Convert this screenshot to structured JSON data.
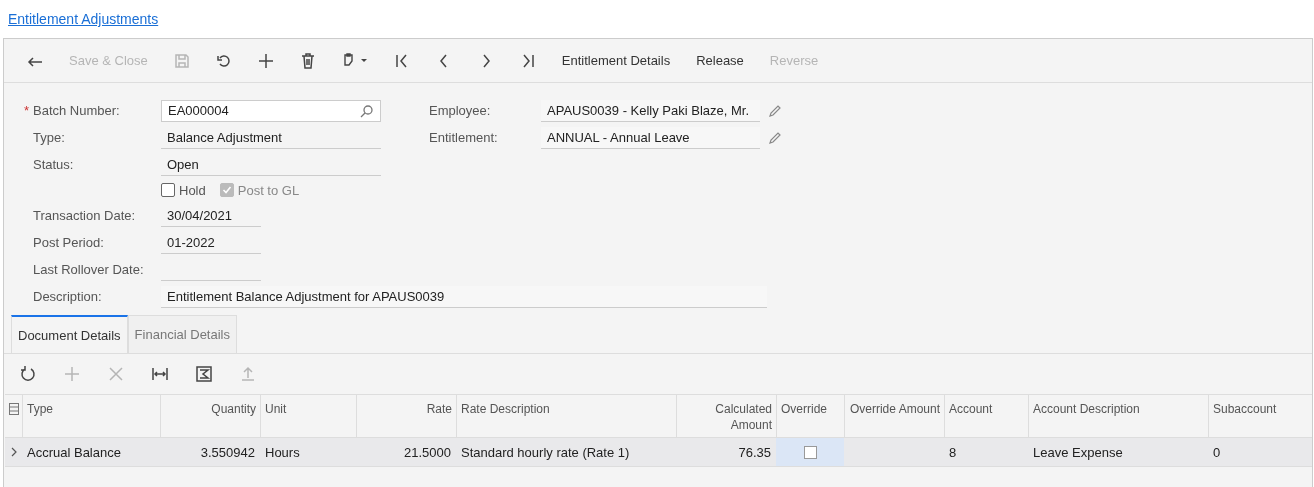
{
  "title": "Entitlement Adjustments",
  "toolbar": [
    {
      "kind": "back",
      "disabled": false
    },
    {
      "kind": "text",
      "label": "Save & Close",
      "disabled": true
    },
    {
      "kind": "save",
      "disabled": true
    },
    {
      "kind": "undo",
      "disabled": false
    },
    {
      "kind": "add",
      "disabled": false
    },
    {
      "kind": "delete",
      "disabled": false
    },
    {
      "kind": "clipboard",
      "disabled": false
    },
    {
      "kind": "first",
      "disabled": false
    },
    {
      "kind": "prev",
      "disabled": false
    },
    {
      "kind": "next",
      "disabled": false
    },
    {
      "kind": "last",
      "disabled": false
    },
    {
      "kind": "text",
      "label": "Entitlement Details",
      "disabled": false
    },
    {
      "kind": "text",
      "label": "Release",
      "disabled": false
    },
    {
      "kind": "text",
      "label": "Reverse",
      "disabled": true
    }
  ],
  "form": {
    "left": [
      {
        "label": "Batch Number:",
        "value": "EA000004",
        "marker": "*",
        "kind": "lookup"
      },
      {
        "label": "Type:",
        "value": "Balance Adjustment",
        "kind": "text"
      },
      {
        "label": "Status:",
        "value": "Open",
        "kind": "text"
      }
    ],
    "checkboxes": [
      {
        "label": "Hold",
        "checked": false,
        "disabled": false
      },
      {
        "label": "Post to GL",
        "checked": true,
        "disabled": true
      }
    ],
    "dates": [
      {
        "label": "Transaction Date:",
        "value": "30/04/2021"
      },
      {
        "label": "Post Period:",
        "value": "01-2022"
      },
      {
        "label": "Last Rollover Date:"
      }
    ],
    "description": {
      "label": "Description:",
      "value": "Entitlement  Balance Adjustment for APAUS0039"
    },
    "right": [
      {
        "label": "Employee:",
        "value": "APAUS0039 - Kelly Paki Blaze, Mr."
      },
      {
        "label": "Entitlement:",
        "value": "ANNUAL - Annual Leave"
      }
    ]
  },
  "tabs": [
    {
      "label": "Document Details",
      "selected": true
    },
    {
      "label": "Financial Details",
      "selected": false
    }
  ],
  "grid_toolbar": [
    {
      "kind": "refresh",
      "disabled": false
    },
    {
      "kind": "add",
      "disabled": true
    },
    {
      "kind": "delete",
      "disabled": true
    },
    {
      "kind": "fit",
      "disabled": false
    },
    {
      "kind": "excel",
      "disabled": false
    },
    {
      "kind": "upload",
      "disabled": true
    }
  ],
  "table": {
    "columns": [
      {
        "label": "Type",
        "numeric": false
      },
      {
        "label": "Quantity",
        "numeric": true
      },
      {
        "label": "Unit",
        "numeric": false
      },
      {
        "label": "Rate",
        "numeric": true
      },
      {
        "label": "Rate Description",
        "numeric": false
      },
      {
        "label": "Calculated Amount",
        "numeric": true
      },
      {
        "label": "Override",
        "numeric": false
      },
      {
        "label": "Override Amount",
        "numeric": true
      },
      {
        "label": "Account",
        "numeric": false
      },
      {
        "label": "Account Description",
        "numeric": false
      },
      {
        "label": "Subaccount",
        "numeric": false
      }
    ],
    "rows": [
      {
        "selected": true,
        "cells": [
          {
            "kind": "text",
            "text": "Accrual Balance"
          },
          {
            "kind": "text",
            "text": "3.550942"
          },
          {
            "kind": "text",
            "text": "Hours"
          },
          {
            "kind": "text",
            "text": "21.5000"
          },
          {
            "kind": "text",
            "text": "Standard hourly rate (Rate 1)"
          },
          {
            "kind": "text",
            "text": "76.35"
          },
          {
            "kind": "checkbox",
            "checked": false,
            "focused": true
          },
          {
            "kind": "empty"
          },
          {
            "kind": "text",
            "text": "8"
          },
          {
            "kind": "text",
            "text": "Leave Expense"
          },
          {
            "kind": "text",
            "text": "0"
          }
        ]
      }
    ]
  }
}
